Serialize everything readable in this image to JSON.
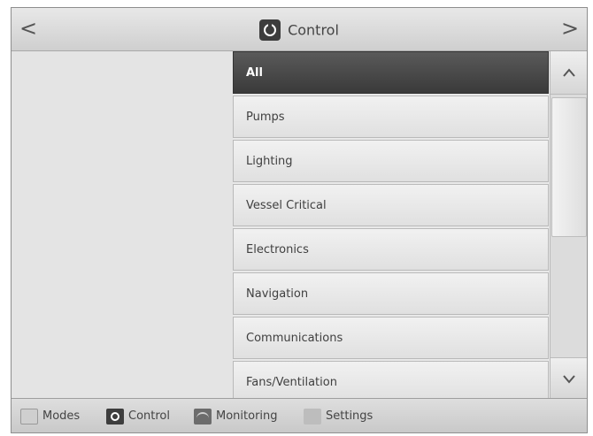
{
  "header": {
    "title": "Control",
    "prev_glyph": "<",
    "next_glyph": ">",
    "title_icon": "control-dial-icon"
  },
  "categories": [
    {
      "label": "All",
      "selected": true
    },
    {
      "label": "Pumps"
    },
    {
      "label": "Lighting"
    },
    {
      "label": "Vessel Critical"
    },
    {
      "label": "Electronics"
    },
    {
      "label": "Navigation"
    },
    {
      "label": "Communications"
    },
    {
      "label": "Fans/Ventilation"
    }
  ],
  "scroll": {
    "up_glyph": "^",
    "down_glyph": "v"
  },
  "bottom_nav": {
    "modes": {
      "label": "Modes",
      "icon": "modes-icon"
    },
    "control": {
      "label": "Control",
      "icon": "control-icon"
    },
    "monitoring": {
      "label": "Monitoring",
      "icon": "monitoring-icon"
    },
    "settings": {
      "label": "Settings",
      "icon": "settings-icon"
    }
  },
  "colors": {
    "selected_bg": "#3d3d3d",
    "selected_text": "#ffffff"
  }
}
